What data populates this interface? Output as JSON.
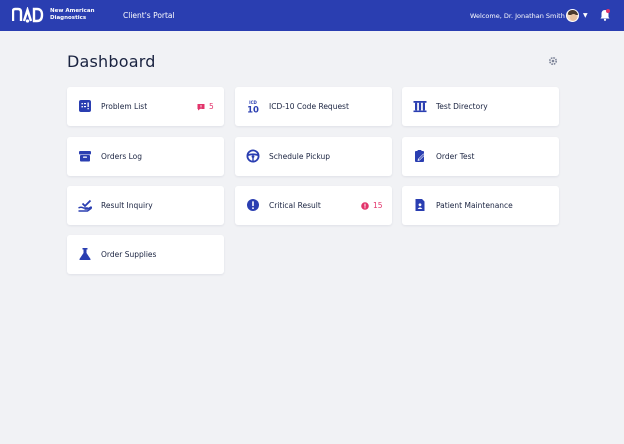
{
  "header": {
    "logo_mark": "NAD",
    "logo_text": "New American Diagnostics",
    "portal_label": "Client's Portal",
    "welcome": "Welcome, Dr. Jonathan Smith",
    "colors": {
      "bar": "#2a3eb1",
      "accent": "#e2346b"
    },
    "icons": {
      "avatar": "user-avatar",
      "caret": "chevron-down-icon",
      "bell": "bell-icon"
    }
  },
  "page": {
    "title": "Dashboard",
    "settings_icon": "gear-icon"
  },
  "cards": [
    {
      "label": "Problem List",
      "icon": "list-alert-icon",
      "badge": "5",
      "badge_icon": "message-alert-icon"
    },
    {
      "label": "ICD-10 Code Request",
      "icon": "icd10-icon"
    },
    {
      "label": "Test Directory",
      "icon": "test-tubes-icon"
    },
    {
      "label": "Orders Log",
      "icon": "archive-box-icon"
    },
    {
      "label": "Schedule Pickup",
      "icon": "steering-wheel-icon"
    },
    {
      "label": "Order Test",
      "icon": "clipboard-pen-icon"
    },
    {
      "label": "Result Inquiry",
      "icon": "hand-check-icon"
    },
    {
      "label": "Critical Result",
      "icon": "alert-circle-icon",
      "badge": "15",
      "badge_icon": "alert-circle-small-icon"
    },
    {
      "label": "Patient Maintenance",
      "icon": "patient-file-icon"
    },
    {
      "label": "Order Supplies",
      "icon": "flask-icon"
    }
  ]
}
